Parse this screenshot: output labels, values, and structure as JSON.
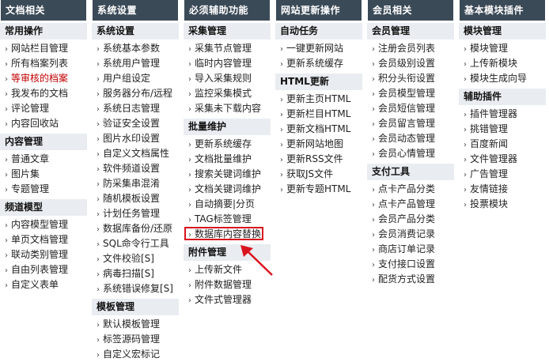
{
  "columns": [
    {
      "header": "文档相关",
      "sections": [
        {
          "title": "常用操作",
          "items": [
            "网站栏目管理",
            "所有档案列表",
            "等审核的档案",
            "我发布的文档",
            "评论管理",
            "内容回收站"
          ]
        },
        {
          "title": "内容管理",
          "items": [
            "普通文章",
            "图片集",
            "专题管理"
          ]
        },
        {
          "title": "频道模型",
          "items": [
            "内容模型管理",
            "单页文档管理",
            "联动类别管理",
            "自由列表管理",
            "自定义表单"
          ]
        }
      ]
    },
    {
      "header": "系统设置",
      "sections": [
        {
          "title": "系统设置",
          "items": [
            "系统基本参数",
            "系统用户管理",
            "用户组设定",
            "服务器分布/远程",
            "系统日志管理",
            "验证安全设置",
            "图片水印设置",
            "自定义文档属性",
            "软件频道设置",
            "防采集串混淆",
            "随机模板设置",
            "计划任务管理",
            "数据库备份/还原",
            "SQL命令行工具",
            "文件校验[S]",
            "病毒扫描[S]",
            "系统错误修复[S]"
          ]
        },
        {
          "title": "模板管理",
          "items": [
            "默认模板管理",
            "标签源码管理",
            "自定义宏标记"
          ]
        }
      ]
    },
    {
      "header": "必须辅助功能",
      "sections": [
        {
          "title": "采集管理",
          "items": [
            "采集节点管理",
            "临时内容管理",
            "导入采集规则",
            "监控采集模式",
            "采集未下载内容"
          ]
        },
        {
          "title": "批量维护",
          "items": [
            "更新系统缓存",
            "文档批量维护",
            "搜索关键词维护",
            "文档关键词维护",
            "自动摘要|分页",
            "TAG标签管理",
            "数据库内容替换"
          ]
        },
        {
          "title": "附件管理",
          "items": [
            "上传新文件",
            "附件数据管理",
            "文件式管理器"
          ]
        }
      ]
    },
    {
      "header": "网站更新操作",
      "sections": [
        {
          "title": "自动任务",
          "items": [
            "一键更新网站",
            "更新系统缓存"
          ]
        },
        {
          "title": "HTML更新",
          "items": [
            "更新主页HTML",
            "更新栏目HTML",
            "更新文档HTML",
            "更新网站地图",
            "更新RSS文件",
            "获取JS文件",
            "更新专题HTML"
          ]
        }
      ]
    },
    {
      "header": "会员相关",
      "sections": [
        {
          "title": "会员管理",
          "items": [
            "注册会员列表",
            "会员级别设置",
            "积分头衔设置",
            "会员模型管理",
            "会员短信管理",
            "会员留言管理",
            "会员动态管理",
            "会员心情管理"
          ]
        },
        {
          "title": "支付工具",
          "items": [
            "点卡产品分类",
            "点卡产品管理",
            "会员产品分类",
            "会员消费记录",
            "商店订单记录",
            "支付接口设置",
            "配货方式设置"
          ]
        }
      ]
    },
    {
      "header": "基本模块插件",
      "sections": [
        {
          "title": "模块管理",
          "items": [
            "模块管理",
            "上传新模块",
            "模块生成向导"
          ]
        },
        {
          "title": "辅助插件",
          "items": [
            "插件管理器",
            "挑错管理",
            "百度新闻",
            "文件管理器",
            "广告管理",
            "友情链接",
            "投票模块"
          ]
        }
      ]
    }
  ],
  "colors": {
    "header_bg": "#3b4a57",
    "section_bg": "#e9edf1",
    "highlight_text": "#c00000",
    "annotation_red": "#d9141e"
  },
  "icons": {
    "bullet": "›",
    "arrow": "red-arrow-icon"
  }
}
